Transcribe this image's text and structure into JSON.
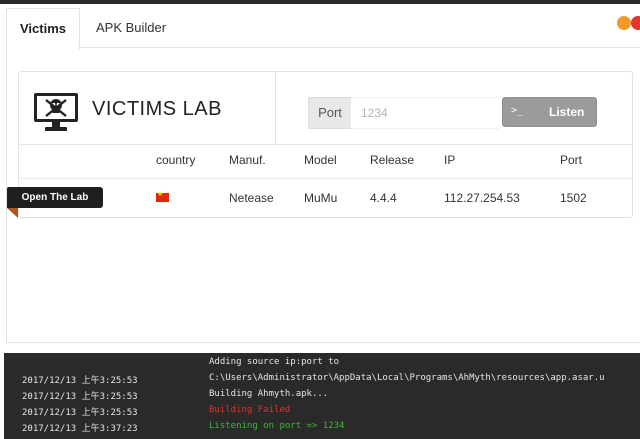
{
  "window": {
    "accent_orange": "#f39a2a",
    "accent_red": "#e3352a"
  },
  "tabs": [
    {
      "label": "Victims",
      "active": true
    },
    {
      "label": "APK Builder",
      "active": false
    }
  ],
  "header": {
    "title": "VICTIMS LAB",
    "icon": "skull-monitor-icon",
    "port_label": "Port",
    "port_placeholder": "1234",
    "listen_icon": ">_",
    "listen_label": "Listen"
  },
  "table": {
    "columns": [
      "country",
      "Manuf.",
      "Model",
      "Release",
      "IP",
      "Port"
    ],
    "rows": [
      {
        "country_flag": "china-flag-icon",
        "manuf": "Netease",
        "model": "MuMu",
        "release": "4.4.4",
        "ip": "112.27.254.53",
        "port": "1502"
      }
    ],
    "open_lab_label": "Open The Lab"
  },
  "console": {
    "lines": [
      {
        "time": "",
        "msg": "Adding source ip:port to",
        "color": "default"
      },
      {
        "time": "2017/12/13 上午3:25:53",
        "msg": "C:\\Users\\Administrator\\AppData\\Local\\Programs\\AhMyth\\resources\\app.asar.u",
        "color": "default"
      },
      {
        "time": "2017/12/13 上午3:25:53",
        "msg": "Building Ahmyth.apk...",
        "color": "default"
      },
      {
        "time": "2017/12/13 上午3:25:53",
        "msg": "Building Failed",
        "color": "red"
      },
      {
        "time": "2017/12/13 上午3:37:23",
        "msg": "Listening on port => 1234",
        "color": "green"
      }
    ]
  }
}
